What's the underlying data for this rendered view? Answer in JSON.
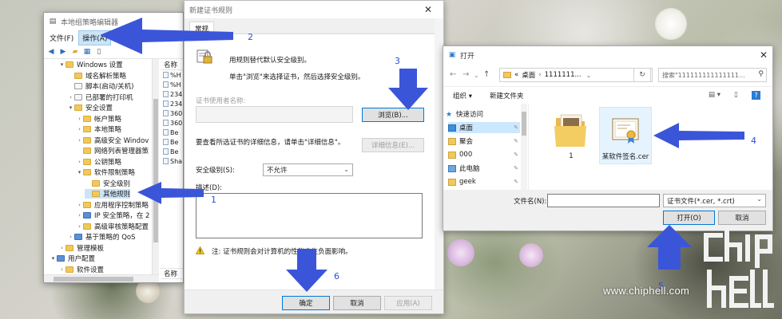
{
  "gpedit": {
    "title": "本地组策略编辑器",
    "menu": [
      "文件(F)",
      "操作(A)"
    ],
    "tree": [
      {
        "label": "Windows 设置",
        "indent": 2,
        "arrow": "▾",
        "icon": "folder"
      },
      {
        "label": "域名解析策略",
        "indent": 3,
        "arrow": "",
        "icon": "folder"
      },
      {
        "label": "脚本(启动/关机)",
        "indent": 3,
        "arrow": "",
        "icon": "page"
      },
      {
        "label": "已部署的打印机",
        "indent": 3,
        "arrow": "›",
        "icon": "page"
      },
      {
        "label": "安全设置",
        "indent": 3,
        "arrow": "▾",
        "icon": "folder"
      },
      {
        "label": "帐户策略",
        "indent": 4,
        "arrow": "›",
        "icon": "folder"
      },
      {
        "label": "本地策略",
        "indent": 4,
        "arrow": "›",
        "icon": "folder"
      },
      {
        "label": "高级安全 Windov",
        "indent": 4,
        "arrow": "›",
        "icon": "folder"
      },
      {
        "label": "网络列表管理器策",
        "indent": 4,
        "arrow": "",
        "icon": "folder"
      },
      {
        "label": "公钥策略",
        "indent": 4,
        "arrow": "›",
        "icon": "folder"
      },
      {
        "label": "软件限制策略",
        "indent": 4,
        "arrow": "▾",
        "icon": "folder"
      },
      {
        "label": "安全级别",
        "indent": 5,
        "arrow": "",
        "icon": "folder"
      },
      {
        "label": "其他规则",
        "indent": 5,
        "arrow": "",
        "icon": "folder",
        "selected": true
      },
      {
        "label": "应用程序控制策略",
        "indent": 4,
        "arrow": "›",
        "icon": "folder"
      },
      {
        "label": "IP 安全策略，在 2",
        "indent": 4,
        "arrow": "›",
        "icon": "blue"
      },
      {
        "label": "高级审核策略配置",
        "indent": 4,
        "arrow": "›",
        "icon": "folder"
      },
      {
        "label": "基于策略的 QoS",
        "indent": 3,
        "arrow": "›",
        "icon": "blue"
      },
      {
        "label": "管理模板",
        "indent": 2,
        "arrow": "›",
        "icon": "folder"
      },
      {
        "label": "用户配置",
        "indent": 1,
        "arrow": "▾",
        "icon": "blue"
      },
      {
        "label": "软件设置",
        "indent": 2,
        "arrow": "›",
        "icon": "folder"
      }
    ],
    "right_header": "名称",
    "right_rows": [
      "%H",
      "%H",
      "234",
      "234",
      "360",
      "360",
      "Be",
      "Be",
      "Be",
      "Sha"
    ],
    "right_footer": "名称"
  },
  "new_rule": {
    "title": "新建证书规则",
    "tab": "常规",
    "intro_line1": "用规则替代默认安全级别。",
    "intro_line2": "单击\"浏览\"来选择证书，然后选择安全级别。",
    "cert_user_label": "证书使用者名称:",
    "browse_button": "浏览(B)...",
    "details_hint": "要查看所选证书的详细信息，请单击\"详细信息\"。",
    "details_button": "详细信息(E)...",
    "level_label": "安全级别(S):",
    "level_value": "不允许",
    "desc_label": "描述(D):",
    "note": "注: 证书规则会对计算机的性能产生负面影响。",
    "ok_button": "确定",
    "cancel_button": "取消",
    "apply_button": "应用(A)"
  },
  "open_dialog": {
    "title": "打开",
    "path": [
      "«",
      "桌面",
      "›",
      "1111111..."
    ],
    "search_placeholder": "搜索\"111111111111111...",
    "organize": "组织 ▾",
    "new_folder": "新建文件夹",
    "nav_items": [
      {
        "label": "快速访问",
        "icon": "star"
      },
      {
        "label": "桌面",
        "icon": "desk",
        "selected": true,
        "pin": true
      },
      {
        "label": "聚会",
        "icon": "folder",
        "pin": true
      },
      {
        "label": "000",
        "icon": "folder",
        "pin": true
      },
      {
        "label": "此电脑",
        "icon": "pc",
        "pin": true
      },
      {
        "label": "geek",
        "icon": "folder",
        "pin": true
      }
    ],
    "files": [
      {
        "name": "1"
      },
      {
        "name": "某软件签名.cer"
      }
    ],
    "filename_label": "文件名(N):",
    "filetype_value": "证书文件(*.cer, *.crt)",
    "open_button": "打开(O)",
    "cancel_button": "取消"
  },
  "annotations": {
    "n1": "1",
    "n2": "2",
    "n3": "3",
    "n4": "4",
    "n5": "5",
    "n6": "6",
    "arrow_color": "#3b55d9"
  },
  "watermark": "www.chiphell.com"
}
